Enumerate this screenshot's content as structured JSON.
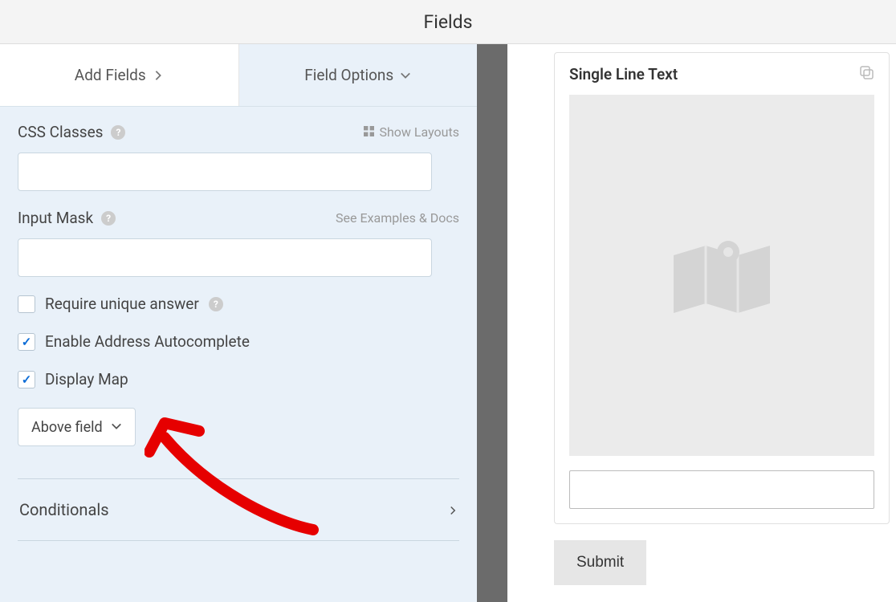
{
  "header": {
    "title": "Fields"
  },
  "tabs": {
    "add_fields": "Add Fields",
    "field_options": "Field Options"
  },
  "options": {
    "css_classes": {
      "label": "CSS Classes",
      "show_layouts": "Show Layouts",
      "value": ""
    },
    "input_mask": {
      "label": "Input Mask",
      "examples_link": "See Examples & Docs",
      "value": ""
    },
    "require_unique": {
      "label": "Require unique answer",
      "checked": false
    },
    "address_autocomplete": {
      "label": "Enable Address Autocomplete",
      "checked": true
    },
    "display_map": {
      "label": "Display Map",
      "checked": true
    },
    "map_position": {
      "selected": "Above field"
    },
    "conditionals": {
      "label": "Conditionals"
    }
  },
  "preview": {
    "title": "Single Line Text",
    "submit": "Submit"
  }
}
